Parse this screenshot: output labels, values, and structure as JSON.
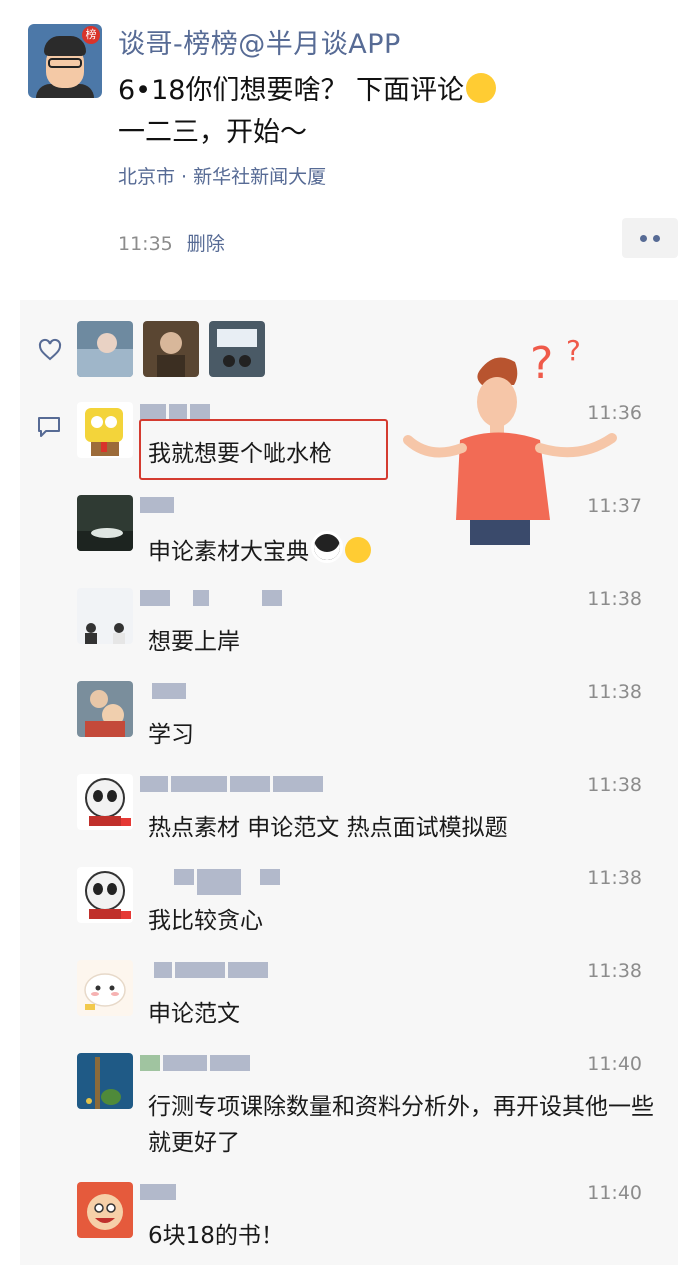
{
  "post": {
    "author": "谈哥-榜榜@半月谈APP",
    "text_line1": "6•18你们想要啥？ 下面评论",
    "text_line2": "一二三，开始～",
    "location": "北京市 · 新华社新闻大厦",
    "time": "11:35",
    "delete_label": "删除",
    "avatar_badge": "榜"
  },
  "comments": [
    {
      "time": "11:36",
      "text": "我就想要个呲水枪"
    },
    {
      "time": "11:37",
      "text": "申论素材大宝典"
    },
    {
      "time": "11:38",
      "text": "想要上岸"
    },
    {
      "time": "11:38",
      "text": "学习"
    },
    {
      "time": "11:38",
      "text": "热点素材 申论范文 热点面试模拟题"
    },
    {
      "time": "11:38",
      "text": "我比较贪心"
    },
    {
      "time": "11:38",
      "text": "申论范文"
    },
    {
      "time": "11:40",
      "text": "行测专项课除数量和资料分析外，再开设其他一些就更好了"
    },
    {
      "time": "11:40",
      "text": "6块18的书！"
    }
  ],
  "icons": {
    "like": "heart-outline-icon",
    "comment": "comment-bubble-icon",
    "more": "more-dots-icon"
  },
  "colors": {
    "link": "#576b95",
    "panel": "#f7f7f7",
    "highlight": "#d43b30"
  }
}
